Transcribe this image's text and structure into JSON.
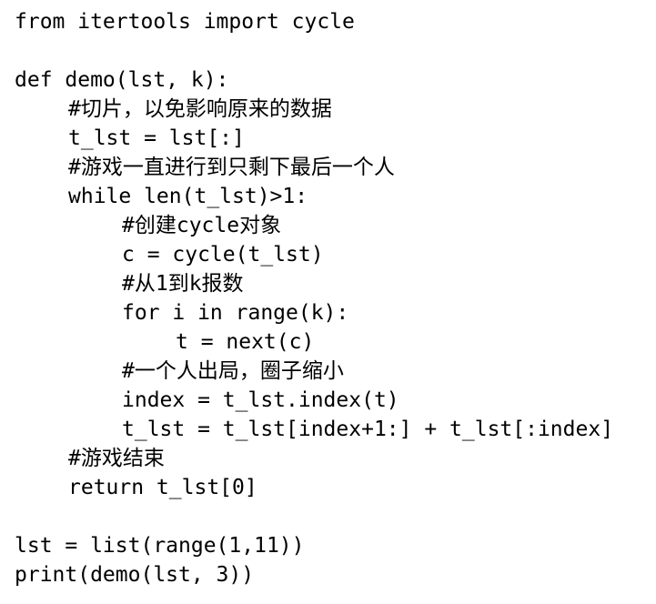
{
  "code": {
    "lines": [
      "from itertools import cycle",
      "",
      "def demo(lst, k):",
      "#切片，以免影响原来的数据",
      "t_lst = lst[:]",
      "#游戏一直进行到只剩下最后一个人",
      "while len(t_lst)>1:",
      "#创建cycle对象",
      "c = cycle(t_lst)",
      "#从1到k报数",
      "for i in range(k):",
      "t = next(c)",
      "#一个人出局，圈子缩小",
      "index = t_lst.index(t)",
      "t_lst = t_lst[index+1:] + t_lst[:index]",
      "#游戏结束",
      "return t_lst[0]",
      "",
      "lst = list(range(1,11))",
      "print(demo(lst, 3))"
    ]
  }
}
